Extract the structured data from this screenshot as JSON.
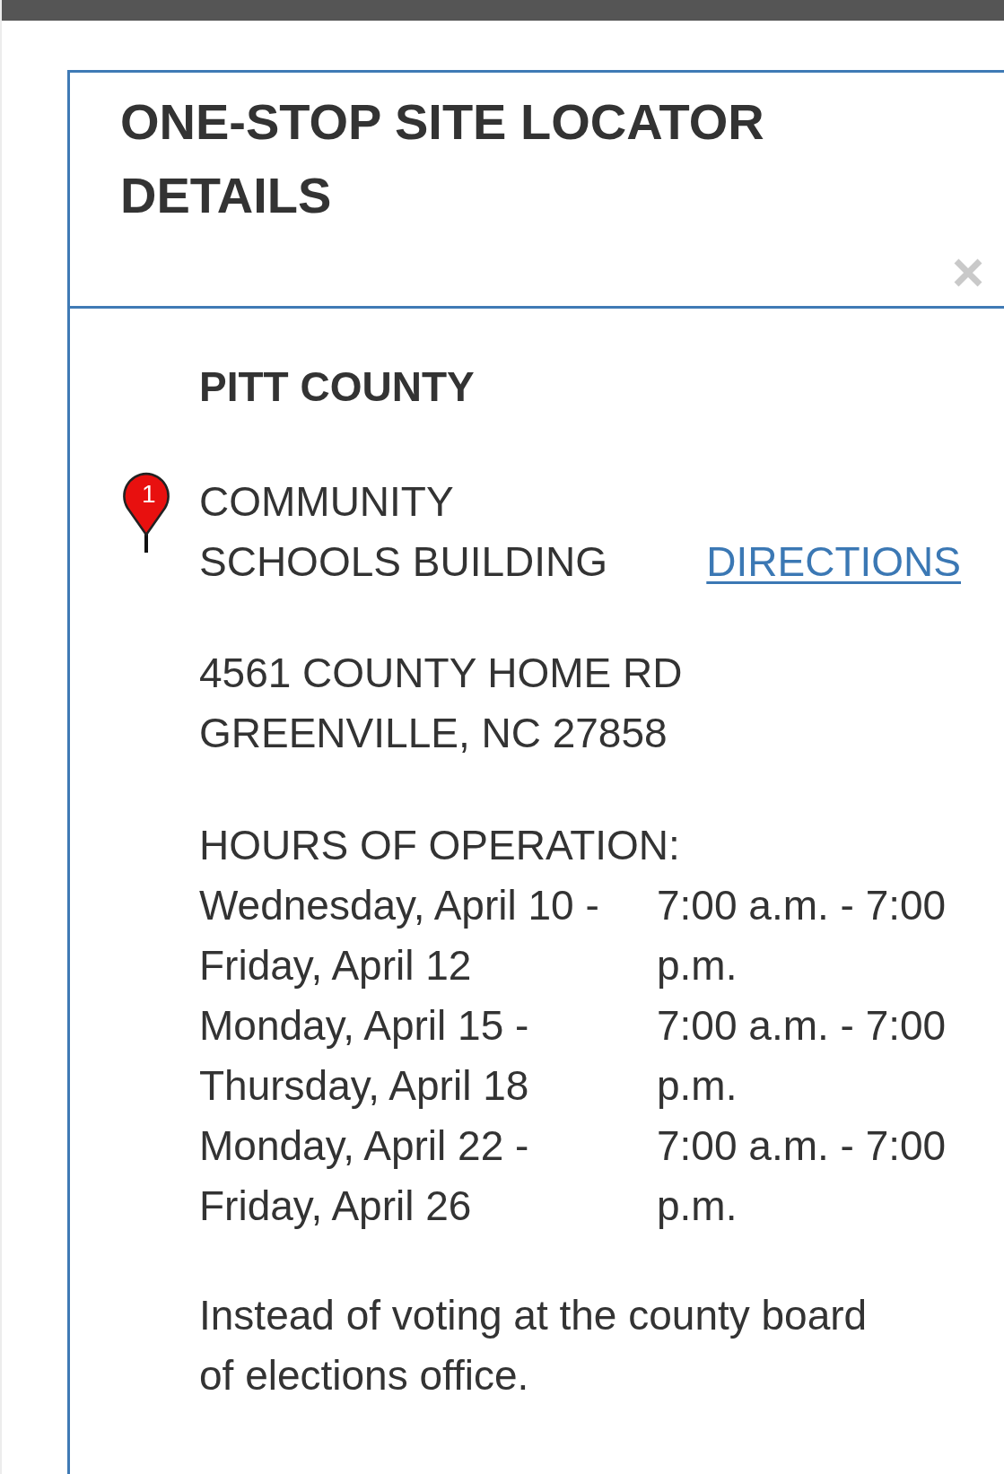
{
  "dialog": {
    "title": "ONE-STOP SITE LOCATOR DETAILS"
  },
  "county": "PITT COUNTY",
  "site": {
    "marker": "1",
    "name": "COMMUNITY SCHOOLS BUILDING",
    "directions_link": "DIRECTIONS",
    "address": [
      "4561 COUNTY HOME RD",
      "GREENVILLE, NC 27858"
    ]
  },
  "hours": {
    "heading": "HOURS OF OPERATION:",
    "rows": [
      {
        "days": "Wednesday, April 10 - Friday, April 12",
        "time": "7:00 a.m. - 7:00 p.m."
      },
      {
        "days": "Monday, April 15 - Thursday, April 18",
        "time": "7:00 a.m. - 7:00 p.m."
      },
      {
        "days": "Monday, April 22 - Friday, April 26",
        "time": "7:00 a.m. - 7:00 p.m."
      }
    ]
  },
  "note": "Instead of voting at the county board of elections office."
}
